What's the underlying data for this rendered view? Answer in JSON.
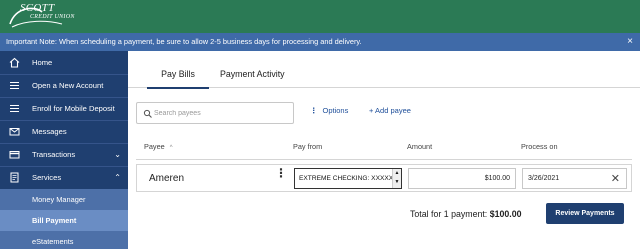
{
  "header": {
    "logo_line1": "SCOTT",
    "logo_line2": "CREDIT UNION",
    "brand_color": "#2b7a55"
  },
  "notice": {
    "text": "Important Note: When scheduling a payment, be sure to allow 2-5 business days for processing and delivery.",
    "close_glyph": "×"
  },
  "sidebar": {
    "items": [
      {
        "label": "Home",
        "icon": "home-icon"
      },
      {
        "label": "Open a New Account",
        "icon": "menu-icon"
      },
      {
        "label": "Enroll for Mobile Deposit",
        "icon": "menu-icon"
      },
      {
        "label": "Messages",
        "icon": "envelope-icon"
      },
      {
        "label": "Transactions",
        "icon": "card-icon",
        "chevron": "⌄"
      },
      {
        "label": "Services",
        "icon": "document-icon",
        "chevron": "⌃"
      }
    ],
    "subitems": [
      {
        "label": "Money Manager"
      },
      {
        "label": "Bill Payment",
        "active": true
      },
      {
        "label": "eStatements"
      }
    ]
  },
  "tabs": [
    {
      "label": "Pay Bills",
      "active": true
    },
    {
      "label": "Payment Activity"
    }
  ],
  "toolbar": {
    "search_placeholder": "Search payees",
    "options_dots": "⋮",
    "options_label": "Options",
    "add_payee_label": "+ Add payee"
  },
  "table": {
    "headers": {
      "payee": "Payee",
      "sort_glyph": "^",
      "pay_from": "Pay from",
      "amount": "Amount",
      "process_on": "Process on"
    },
    "rows": [
      {
        "payee": "Ameren",
        "kebab": "⋮",
        "account": "EXTREME CHECKING: XXXXX",
        "amount": "$100.00",
        "date": "3/26/2021",
        "clear_glyph": "✕"
      }
    ]
  },
  "footer": {
    "total_label": "Total for 1 payment:",
    "total_value": "$100.00",
    "review_button": "Review Payments"
  }
}
